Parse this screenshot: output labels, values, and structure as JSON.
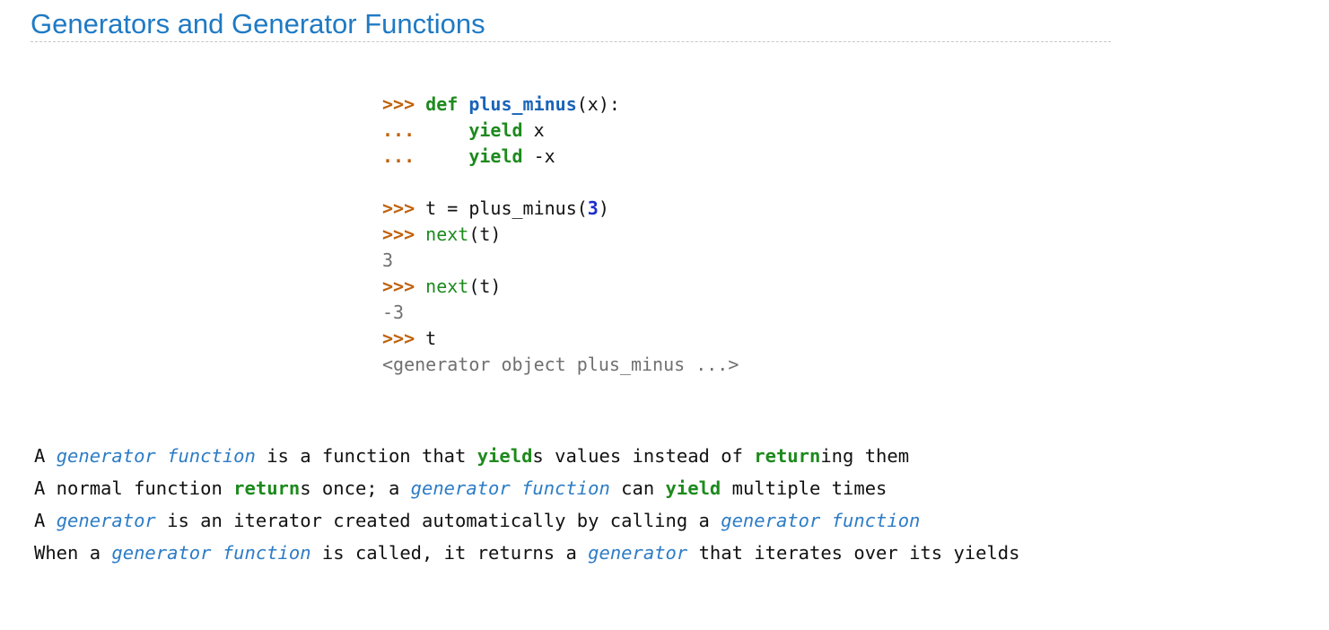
{
  "title": "Generators and Generator Functions",
  "code": {
    "lines": [
      {
        "prompt": ">>>",
        "kw": "def",
        "sp": " ",
        "fname": "plus_minus",
        "rest": "(x):"
      },
      {
        "prompt": "...",
        "indent": "     ",
        "kw": "yield",
        "rest": " x"
      },
      {
        "prompt": "...",
        "indent": "     ",
        "kw": "yield",
        "rest": " -x"
      },
      {
        "prompt": ">>>",
        "pre": " t = plus_minus(",
        "num": "3",
        "post": ")"
      },
      {
        "prompt": ">>>",
        "sp": " ",
        "builtin": "next",
        "rest": "(t)"
      },
      {
        "output": "3"
      },
      {
        "prompt": ">>>",
        "sp": " ",
        "builtin": "next",
        "rest": "(t)"
      },
      {
        "output": "-3"
      },
      {
        "prompt": ">>>",
        "rest": " t"
      },
      {
        "output": "<generator object plus_minus ...>"
      }
    ]
  },
  "bullets": {
    "b1": {
      "t1": "A ",
      "term1": "generator function",
      "t2": " is a function that ",
      "kw1": "yield",
      "t3": "s values instead of ",
      "kw2": "return",
      "t4": "ing them"
    },
    "b2": {
      "t1": "A normal function ",
      "kw1": "return",
      "t2": "s once; a ",
      "term1": "generator function",
      "t3": " can ",
      "kw2": "yield",
      "t4": " multiple times"
    },
    "b3": {
      "t1": "A ",
      "term1": "generator",
      "t2": " is an iterator created automatically by calling a ",
      "term2": "generator function"
    },
    "b4": {
      "t1": "When a ",
      "term1": "generator function",
      "t2": " is called, it returns a ",
      "term2": "generator",
      "t3": " that iterates over its yields"
    }
  },
  "colors": {
    "title": "#1f7ac4",
    "prompt": "#c0620c",
    "keyword": "#1d8a1d",
    "function_name": "#1a63b8",
    "number": "#1c2fc9",
    "output": "#707070",
    "term": "#2d7cc6"
  }
}
